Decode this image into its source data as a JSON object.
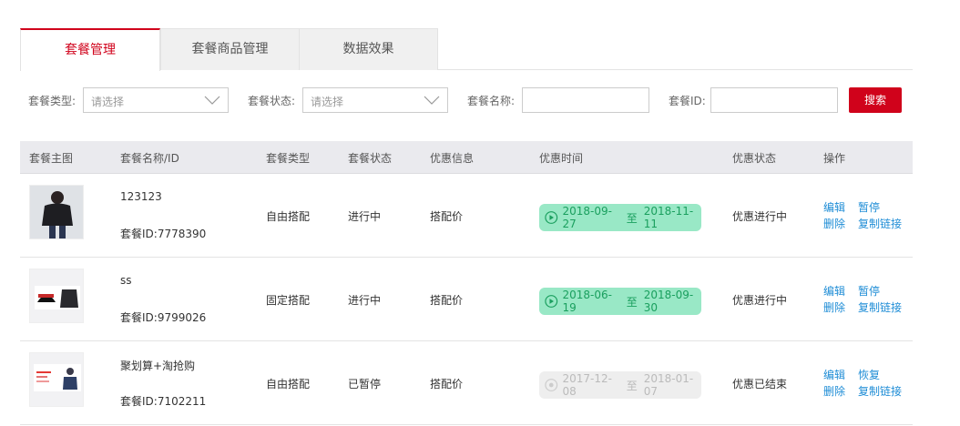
{
  "tabs": [
    {
      "label": "套餐管理",
      "active": true
    },
    {
      "label": "套餐商品管理",
      "active": false
    },
    {
      "label": "数据效果",
      "active": false
    }
  ],
  "filters": {
    "type_label": "套餐类型:",
    "type_placeholder": "请选择",
    "status_label": "套餐状态:",
    "status_placeholder": "请选择",
    "name_label": "套餐名称:",
    "name_value": "",
    "id_label": "套餐ID:",
    "id_value": "",
    "search_button": "搜索"
  },
  "table": {
    "headers": [
      "套餐主图",
      "套餐名称/ID",
      "套餐类型",
      "套餐状态",
      "优惠信息",
      "优惠时间",
      "优惠状态",
      "操作"
    ],
    "rows": [
      {
        "name": "123123",
        "id": "套餐ID:7778390",
        "type": "自由搭配",
        "status": "进行中",
        "discount": "搭配价",
        "time_start": "2018-09-27",
        "time_sep": "至",
        "time_end": "2018-11-11",
        "time_active": true,
        "promo_status": "优惠进行中",
        "actions": [
          "编辑",
          "暂停",
          "删除",
          "复制链接"
        ]
      },
      {
        "name": "ss",
        "id": "套餐ID:9799026",
        "type": "固定搭配",
        "status": "进行中",
        "discount": "搭配价",
        "time_start": "2018-06-19",
        "time_sep": "至",
        "time_end": "2018-09-30",
        "time_active": true,
        "promo_status": "优惠进行中",
        "actions": [
          "编辑",
          "暂停",
          "删除",
          "复制链接"
        ]
      },
      {
        "name": "聚划算+淘抢购",
        "id": "套餐ID:7102211",
        "type": "自由搭配",
        "status": "已暂停",
        "discount": "搭配价",
        "time_start": "2017-12-08",
        "time_sep": "至",
        "time_end": "2018-01-07",
        "time_active": false,
        "promo_status": "优惠已结束",
        "actions": [
          "编辑",
          "恢复",
          "删除",
          "复制链接"
        ]
      }
    ]
  },
  "colors": {
    "accent": "#d0021b",
    "link": "#1f8dd6",
    "pill_active_bg": "#99e8c6",
    "pill_active_text": "#1a9f5e"
  }
}
